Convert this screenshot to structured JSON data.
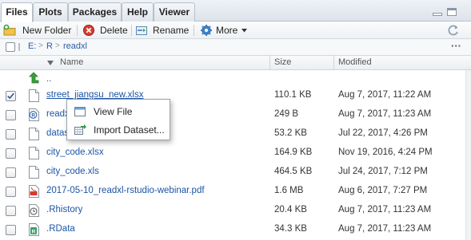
{
  "tabs": [
    {
      "label": "Files",
      "active": true
    },
    {
      "label": "Plots",
      "active": false
    },
    {
      "label": "Packages",
      "active": false
    },
    {
      "label": "Help",
      "active": false
    },
    {
      "label": "Viewer",
      "active": false
    }
  ],
  "toolbar": {
    "new_folder": "New Folder",
    "delete": "Delete",
    "rename": "Rename",
    "more": "More"
  },
  "breadcrumb": [
    "E:",
    "R",
    "readxl"
  ],
  "columns": {
    "name": "Name",
    "size": "Size",
    "modified": "Modified"
  },
  "parent_label": "..",
  "files": [
    {
      "name": "street_jiangsu_new.xlsx",
      "size": "110.1 KB",
      "modified": "Aug 7, 2017, 11:22 AM",
      "checked": true,
      "icon": "file-icon"
    },
    {
      "name": "readxl.Rproj",
      "size": "249 B",
      "modified": "Aug 7, 2017, 11:23 AM",
      "checked": false,
      "icon": "rproj-icon"
    },
    {
      "name": "datasets.xlsx",
      "size": "53.2 KB",
      "modified": "Jul 22, 2017, 4:26 PM",
      "checked": false,
      "icon": "file-icon"
    },
    {
      "name": "city_code.xlsx",
      "size": "164.9 KB",
      "modified": "Nov 19, 2016, 4:24 PM",
      "checked": false,
      "icon": "file-icon"
    },
    {
      "name": "city_code.xls",
      "size": "464.5 KB",
      "modified": "Jul 24, 2017, 7:12 PM",
      "checked": false,
      "icon": "file-icon"
    },
    {
      "name": "2017-05-10_readxl-rstudio-webinar.pdf",
      "size": "1.6 MB",
      "modified": "Aug 6, 2017, 7:27 PM",
      "checked": false,
      "icon": "pdf-icon"
    },
    {
      "name": ".Rhistory",
      "size": "20.4 KB",
      "modified": "Aug 7, 2017, 11:23 AM",
      "checked": false,
      "icon": "history-icon"
    },
    {
      "name": ".RData",
      "size": "34.3 KB",
      "modified": "Aug 7, 2017, 11:23 AM",
      "checked": false,
      "icon": "rdata-icon"
    }
  ],
  "context_menu": {
    "view_file": "View File",
    "import_dataset": "Import Dataset..."
  },
  "colors": {
    "link": "#1c55a6",
    "accent": "#2b5fa8"
  }
}
